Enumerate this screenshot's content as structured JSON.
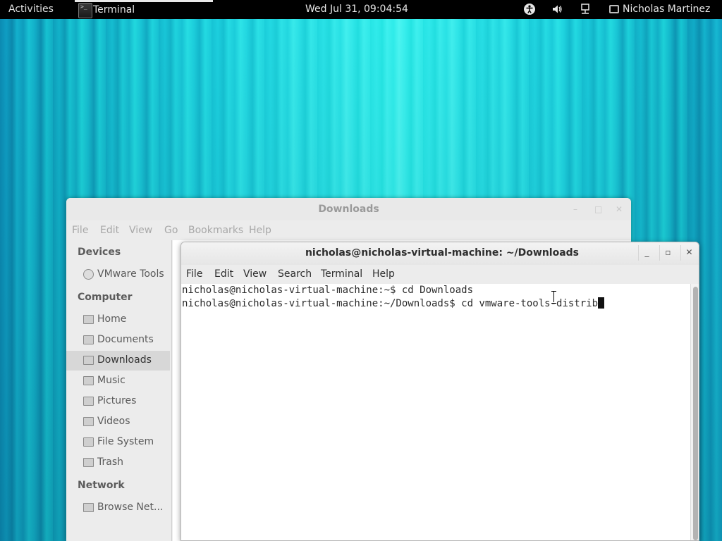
{
  "topbar": {
    "activities": "Activities",
    "app_name": "Terminal",
    "app_icon_text": ">_",
    "clock": "Wed Jul 31, 09:04:54",
    "user_name": "Nicholas Martinez"
  },
  "files_window": {
    "title": "Downloads",
    "menu": [
      "File",
      "Edit",
      "View",
      "Go",
      "Bookmarks",
      "Help"
    ],
    "sections": {
      "devices": "Devices",
      "computer": "Computer",
      "network": "Network"
    },
    "device_items": [
      "VMware Tools"
    ],
    "computer_items": [
      "Home",
      "Documents",
      "Downloads",
      "Music",
      "Pictures",
      "Videos",
      "File System",
      "Trash"
    ],
    "network_items": [
      "Browse Net..."
    ],
    "active_item": "Downloads"
  },
  "terminal_window": {
    "title": "nicholas@nicholas-virtual-machine: ~/Downloads",
    "menu": [
      "File",
      "Edit",
      "View",
      "Search",
      "Terminal",
      "Help"
    ],
    "lines": [
      "nicholas@nicholas-virtual-machine:~$ cd Downloads",
      "nicholas@nicholas-virtual-machine:~/Downloads$ cd vmware-tools-distrib"
    ]
  }
}
